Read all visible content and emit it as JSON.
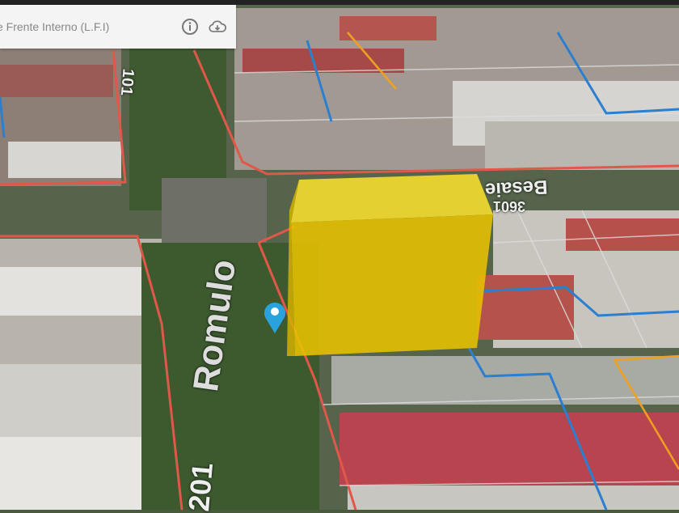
{
  "panel": {
    "title": "e Frente Interno (L.F.I)",
    "info_icon": "info-icon",
    "download_icon": "cloud-download-icon"
  },
  "map_labels": {
    "street_main": "Romulo",
    "number_bottom": "201",
    "number_top": "101",
    "street_right": "Besaie",
    "number_right": "3601"
  },
  "colors": {
    "parcel_border": "#e0584a",
    "blue_line": "#2a7fd0",
    "orange_line": "#f0a020",
    "volume": "#f2cc00",
    "marker": "#2aa3dc"
  }
}
